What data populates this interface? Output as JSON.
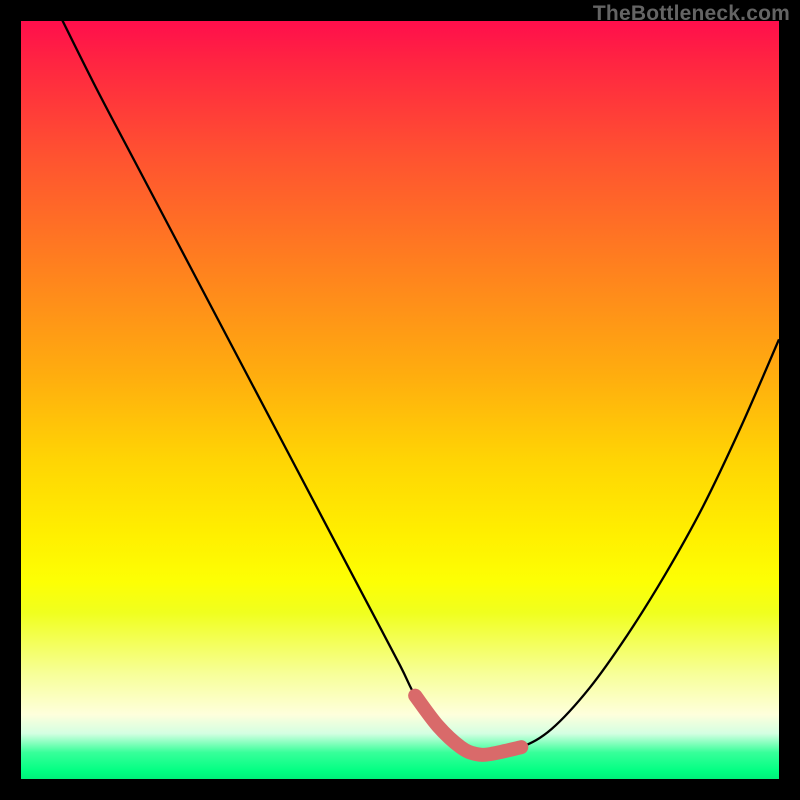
{
  "watermark": "TheBottleneck.com",
  "colors": {
    "curve": "#000000",
    "marker": "#d96a6a",
    "frame": "#000000"
  },
  "chart_data": {
    "type": "line",
    "title": "",
    "xlabel": "",
    "ylabel": "",
    "xlim": [
      0,
      100
    ],
    "ylim": [
      0,
      100
    ],
    "grid": false,
    "series": [
      {
        "name": "bottleneck-curve",
        "x": [
          0,
          5,
          10,
          15,
          20,
          25,
          30,
          35,
          40,
          45,
          50,
          52,
          55,
          58,
          60,
          62,
          66,
          70,
          75,
          80,
          85,
          90,
          95,
          100
        ],
        "values": [
          111,
          101,
          91,
          81.5,
          72,
          62.5,
          53,
          43.5,
          34,
          24.5,
          15,
          11,
          7,
          4.2,
          3.3,
          3.3,
          4.2,
          6.6,
          12,
          19,
          27,
          36,
          46.5,
          58
        ],
        "note": "values are percent height from bottom; curve exceeds 100 at x=0 (clipped at top of plot)"
      }
    ],
    "annotations": [
      {
        "name": "optimum-highlight",
        "type": "segment",
        "x": [
          52,
          66
        ],
        "values": [
          11,
          4.2
        ],
        "style": "thick-rounded",
        "color": "#d96a6a"
      }
    ]
  }
}
